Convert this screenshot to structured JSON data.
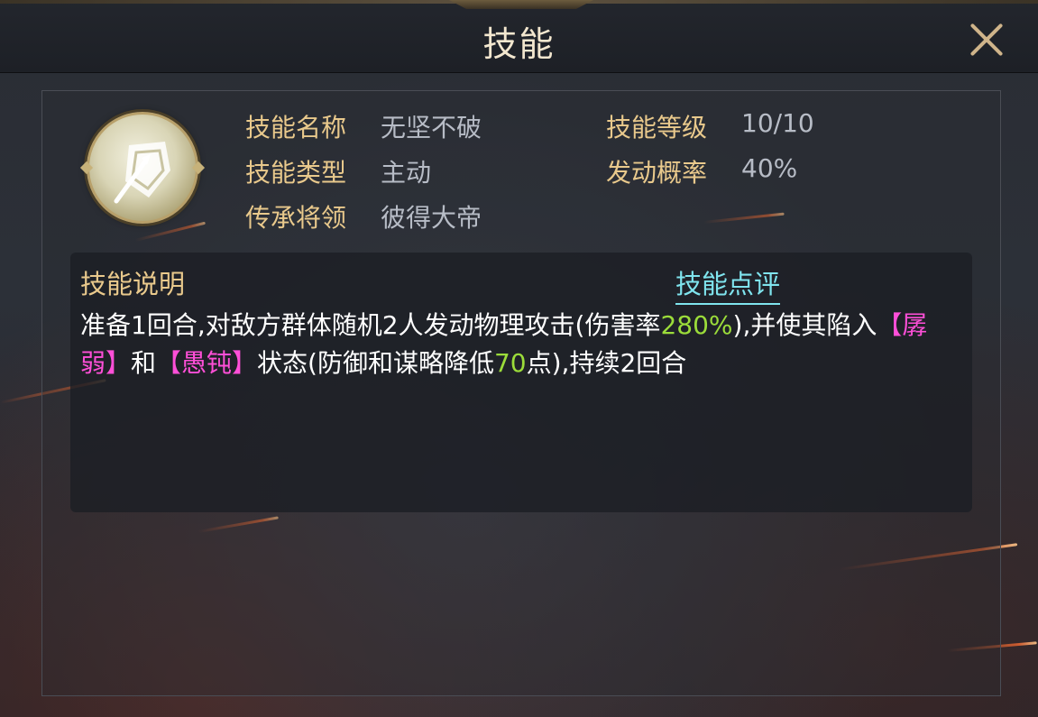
{
  "window": {
    "title": "技能",
    "close_icon": "close-icon"
  },
  "skill": {
    "icon": "shield-spear-icon",
    "name_label": "技能名称",
    "name_value": "无坚不破",
    "level_label": "技能等级",
    "level_value": "10/10",
    "type_label": "技能类型",
    "type_value": "主动",
    "rate_label": "发动概率",
    "rate_value": "40%",
    "heir_label": "传承将领",
    "heir_value": "彼得大帝"
  },
  "description": {
    "title": "技能说明",
    "review_link": "技能点评",
    "segments": {
      "s1": "准备1回合,对敌方群体随机2人发动物理攻击(伤害率",
      "s2": "280%",
      "s3": "),并使其陷入",
      "s4": "【孱弱】",
      "s5": "和",
      "s6": "【愚钝】",
      "s7": "状态(防御和谋略降低",
      "s8": "70",
      "s9": "点),持续2回合"
    }
  },
  "colors": {
    "label_gold": "#e9c98c",
    "value_gray": "#b7bcc6",
    "link_cyan": "#7fe4ee",
    "highlight_green": "#9bdc3a",
    "status_pink": "#ff4fd8"
  }
}
